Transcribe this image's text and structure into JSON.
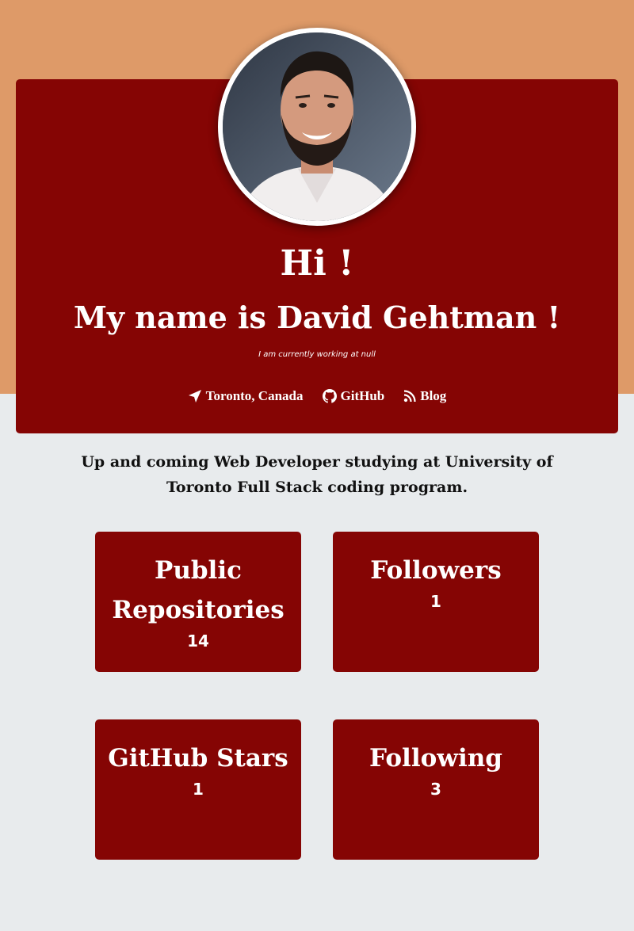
{
  "hero": {
    "greeting": "Hi !",
    "name_line": "My name is David Gehtman !",
    "working_line": "I am currently working at null",
    "avatar_alt": "profile photo"
  },
  "links": [
    {
      "label": "Toronto, Canada",
      "icon": "location-arrow-icon"
    },
    {
      "label": "GitHub",
      "icon": "github-icon"
    },
    {
      "label": "Blog",
      "icon": "rss-icon"
    }
  ],
  "bio": "Up and coming Web Developer studying at University of Toronto Full Stack coding program.",
  "stats": [
    {
      "title": "Public Repositories",
      "value": "14"
    },
    {
      "title": "Followers",
      "value": "1"
    },
    {
      "title": "GitHub Stars",
      "value": "1"
    },
    {
      "title": "Following",
      "value": "3"
    }
  ],
  "colors": {
    "top_band": "#de9a68",
    "card": "#850504",
    "page_background": "#e8ebed",
    "text_light": "#ffffff"
  }
}
